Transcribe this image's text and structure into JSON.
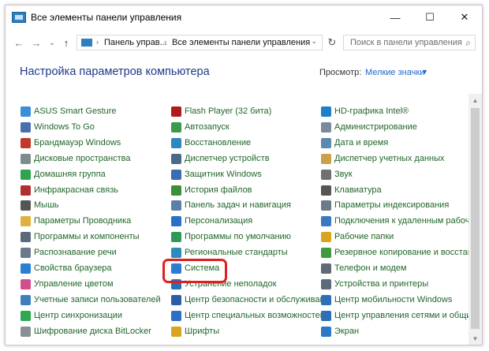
{
  "window": {
    "title": "Все элементы панели управления",
    "minimize_glyph": "—",
    "maximize_glyph": "☐",
    "close_glyph": "✕"
  },
  "nav": {
    "back_glyph": "←",
    "forward_glyph": "→",
    "up_glyph": "↑",
    "recent_glyph": "⌄",
    "breadcrumb_sep": "›",
    "breadcrumb": [
      "Панель управ...",
      "Все элементы панели управления"
    ],
    "address_drop": "⌄",
    "refresh_glyph": "↻",
    "search_placeholder": "Поиск в панели управления",
    "search_glyph": "⌕"
  },
  "content": {
    "title": "Настройка параметров компьютера",
    "view_by_label": "Просмотр:",
    "view_by_value": "Мелкие значки",
    "view_by_caret": "▼"
  },
  "scrollbar": {
    "up": "▲",
    "down": "▼"
  },
  "columns": [
    [
      {
        "label": "ASUS Smart Gesture",
        "icon": "touchpad-icon"
      },
      {
        "label": "Windows To Go",
        "icon": "usb-drive-icon"
      },
      {
        "label": "Брандмауэр Windows",
        "icon": "firewall-icon"
      },
      {
        "label": "Дисковые пространства",
        "icon": "storage-spaces-icon"
      },
      {
        "label": "Домашняя группа",
        "icon": "homegroup-icon"
      },
      {
        "label": "Инфракрасная связь",
        "icon": "infrared-icon"
      },
      {
        "label": "Мышь",
        "icon": "mouse-icon"
      },
      {
        "label": "Параметры Проводника",
        "icon": "explorer-options-icon"
      },
      {
        "label": "Программы и компоненты",
        "icon": "programs-icon"
      },
      {
        "label": "Распознавание речи",
        "icon": "speech-icon"
      },
      {
        "label": "Свойства браузера",
        "icon": "browser-icon"
      },
      {
        "label": "Управление цветом",
        "icon": "color-management-icon"
      },
      {
        "label": "Учетные записи пользователей",
        "icon": "users-icon"
      },
      {
        "label": "Центр синхронизации",
        "icon": "sync-center-icon"
      },
      {
        "label": "Шифрование диска BitLocker",
        "icon": "bitlocker-icon"
      }
    ],
    [
      {
        "label": "Flash Player (32 бита)",
        "icon": "flash-icon"
      },
      {
        "label": "Автозапуск",
        "icon": "autoplay-icon"
      },
      {
        "label": "Восстановление",
        "icon": "recovery-icon"
      },
      {
        "label": "Диспетчер устройств",
        "icon": "device-manager-icon"
      },
      {
        "label": "Защитник Windows",
        "icon": "defender-icon"
      },
      {
        "label": "История файлов",
        "icon": "file-history-icon"
      },
      {
        "label": "Панель задач и навигация",
        "icon": "taskbar-icon"
      },
      {
        "label": "Персонализация",
        "icon": "personalization-icon"
      },
      {
        "label": "Программы по умолчанию",
        "icon": "default-programs-icon"
      },
      {
        "label": "Региональные стандарты",
        "icon": "region-icon"
      },
      {
        "label": "Система",
        "icon": "system-icon"
      },
      {
        "label": "Устранение неполадок",
        "icon": "troubleshooting-icon"
      },
      {
        "label": "Центр безопасности и обслуживан...",
        "icon": "security-center-icon"
      },
      {
        "label": "Центр специальных возможностей",
        "icon": "accessibility-icon"
      },
      {
        "label": "Шрифты",
        "icon": "fonts-icon"
      }
    ],
    [
      {
        "label": "HD-графика Intel®",
        "icon": "intel-graphics-icon"
      },
      {
        "label": "Администрирование",
        "icon": "admin-tools-icon"
      },
      {
        "label": "Дата и время",
        "icon": "clock-icon"
      },
      {
        "label": "Диспетчер учетных данных",
        "icon": "credential-manager-icon"
      },
      {
        "label": "Звук",
        "icon": "sound-icon"
      },
      {
        "label": "Клавиатура",
        "icon": "keyboard-icon"
      },
      {
        "label": "Параметры индексирования",
        "icon": "indexing-icon"
      },
      {
        "label": "Подключения к удаленным рабоч...",
        "icon": "remote-desktop-icon"
      },
      {
        "label": "Рабочие папки",
        "icon": "work-folders-icon"
      },
      {
        "label": "Резервное копирование и восстан...",
        "icon": "backup-icon"
      },
      {
        "label": "Телефон и модем",
        "icon": "phone-modem-icon"
      },
      {
        "label": "Устройства и принтеры",
        "icon": "devices-printers-icon"
      },
      {
        "label": "Центр мобильности Windows",
        "icon": "mobility-center-icon"
      },
      {
        "label": "Центр управления сетями и общи...",
        "icon": "network-center-icon"
      },
      {
        "label": "Экран",
        "icon": "display-icon"
      }
    ]
  ],
  "icon_colors": {
    "touchpad-icon": "#3a8fd6",
    "usb-drive-icon": "#4a6fae",
    "firewall-icon": "#c0392b",
    "storage-spaces-icon": "#7f8c8d",
    "homegroup-icon": "#2ea44f",
    "infrared-icon": "#b03030",
    "mouse-icon": "#555555",
    "explorer-options-icon": "#e0b040",
    "programs-icon": "#5a6a7a",
    "speech-icon": "#6b7b8b",
    "browser-icon": "#2a7fd4",
    "color-management-icon": "#d24d8c",
    "users-icon": "#3f7fbf",
    "sync-center-icon": "#2fa84f",
    "bitlocker-icon": "#8a8f96",
    "flash-icon": "#b01c1c",
    "autoplay-icon": "#3a9a4a",
    "recovery-icon": "#2e86c1",
    "device-manager-icon": "#4a6a8a",
    "defender-icon": "#3a6db3",
    "file-history-icon": "#3a8f3a",
    "taskbar-icon": "#5a7fa8",
    "personalization-icon": "#2a6fc8",
    "default-programs-icon": "#2e9a5a",
    "region-icon": "#2e8bc0",
    "system-icon": "#2b7bd0",
    "troubleshooting-icon": "#2b6fb8",
    "security-center-icon": "#2a5fa8",
    "accessibility-icon": "#2b70c4",
    "fonts-icon": "#d9a520",
    "intel-graphics-icon": "#1e7fc7",
    "admin-tools-icon": "#7a8a9a",
    "clock-icon": "#5a8ab0",
    "credential-manager-icon": "#c9a14a",
    "sound-icon": "#707070",
    "keyboard-icon": "#555555",
    "indexing-icon": "#6a7a8a",
    "remote-desktop-icon": "#3b78c2",
    "work-folders-icon": "#d9a520",
    "backup-icon": "#3f9a3f",
    "phone-modem-icon": "#606b77",
    "devices-printers-icon": "#5a6a7a",
    "mobility-center-icon": "#2e6fb8",
    "network-center-icon": "#2d6eb5",
    "display-icon": "#2d79c9"
  },
  "colors": {
    "link": "#21662a",
    "title": "#1e3a8a",
    "accent": "#1b66c9",
    "highlight": "#e02020"
  }
}
